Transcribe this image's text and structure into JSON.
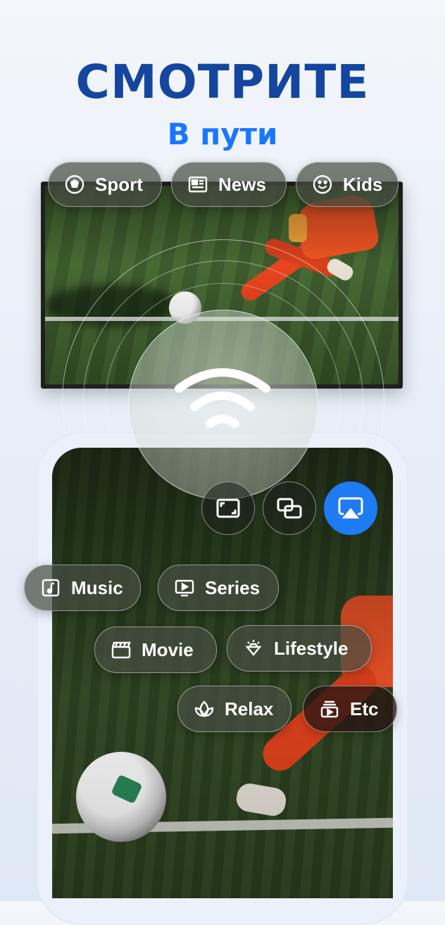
{
  "headline": "СМОТРИТЕ",
  "subheadline": "В пути",
  "tv_categories": [
    {
      "label": "Sport",
      "icon": "soccer-ball-icon"
    },
    {
      "label": "News",
      "icon": "newspaper-icon"
    },
    {
      "label": "Kids",
      "icon": "smiley-icon"
    }
  ],
  "phone_categories": [
    {
      "label": "Music",
      "icon": "music-icon"
    },
    {
      "label": "Series",
      "icon": "tv-play-icon"
    },
    {
      "label": "Movie",
      "icon": "clapperboard-icon"
    },
    {
      "label": "Lifestyle",
      "icon": "diamond-icon"
    },
    {
      "label": "Relax",
      "icon": "lotus-icon"
    },
    {
      "label": "Etc",
      "icon": "playlist-icon"
    }
  ],
  "controls": [
    {
      "name": "fullscreen",
      "icon": "aspect-ratio-icon",
      "active": false
    },
    {
      "name": "mirror",
      "icon": "screen-mirror-icon",
      "active": false
    },
    {
      "name": "cast",
      "icon": "airplay-icon",
      "active": true
    }
  ],
  "colors": {
    "headline": "#1446a0",
    "subheadline": "#1976ff",
    "active_control": "#1f7bf2"
  }
}
